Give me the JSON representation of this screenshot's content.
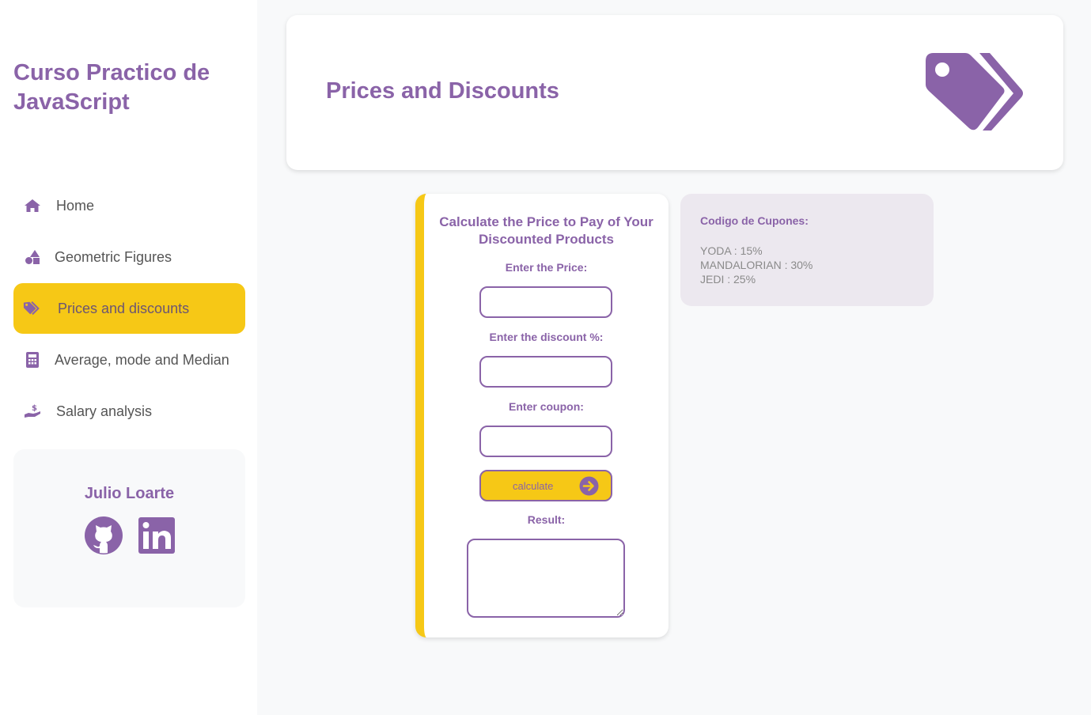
{
  "sidebar": {
    "title": "Curso Practico de JavaScript",
    "nav": [
      {
        "label": "Home",
        "icon": "home-icon"
      },
      {
        "label": "Geometric Figures",
        "icon": "shapes-icon"
      },
      {
        "label": "Prices and discounts",
        "icon": "tags-icon",
        "active": true
      },
      {
        "label": "Average, mode and Median",
        "icon": "calculator-icon"
      },
      {
        "label": "Salary analysis",
        "icon": "hand-money-icon"
      }
    ],
    "profile": {
      "name": "Julio Loarte",
      "links": [
        {
          "icon": "github-icon"
        },
        {
          "icon": "linkedin-icon"
        }
      ]
    }
  },
  "header": {
    "title": "Prices and Discounts",
    "icon": "tags-icon"
  },
  "form": {
    "title": "Calculate the Price to Pay of Your Discounted Products",
    "price_label": "Enter the Price:",
    "price_value": "",
    "discount_label": "Enter the discount %:",
    "discount_value": "",
    "coupon_label": "Enter coupon:",
    "coupon_value": "",
    "button_label": "calculate",
    "button_icon": "arrow-right-circle-icon",
    "result_label": "Result:",
    "result_value": ""
  },
  "coupons": {
    "title": "Codigo de Cupones:",
    "items": [
      "YODA : 15%",
      "MANDALORIAN : 30%",
      "JEDI : 25%"
    ]
  },
  "colors": {
    "accent": "#8a63a8",
    "highlight": "#f6c816",
    "background": "#f8f9fa",
    "coupon_bg": "#ece8ef"
  }
}
